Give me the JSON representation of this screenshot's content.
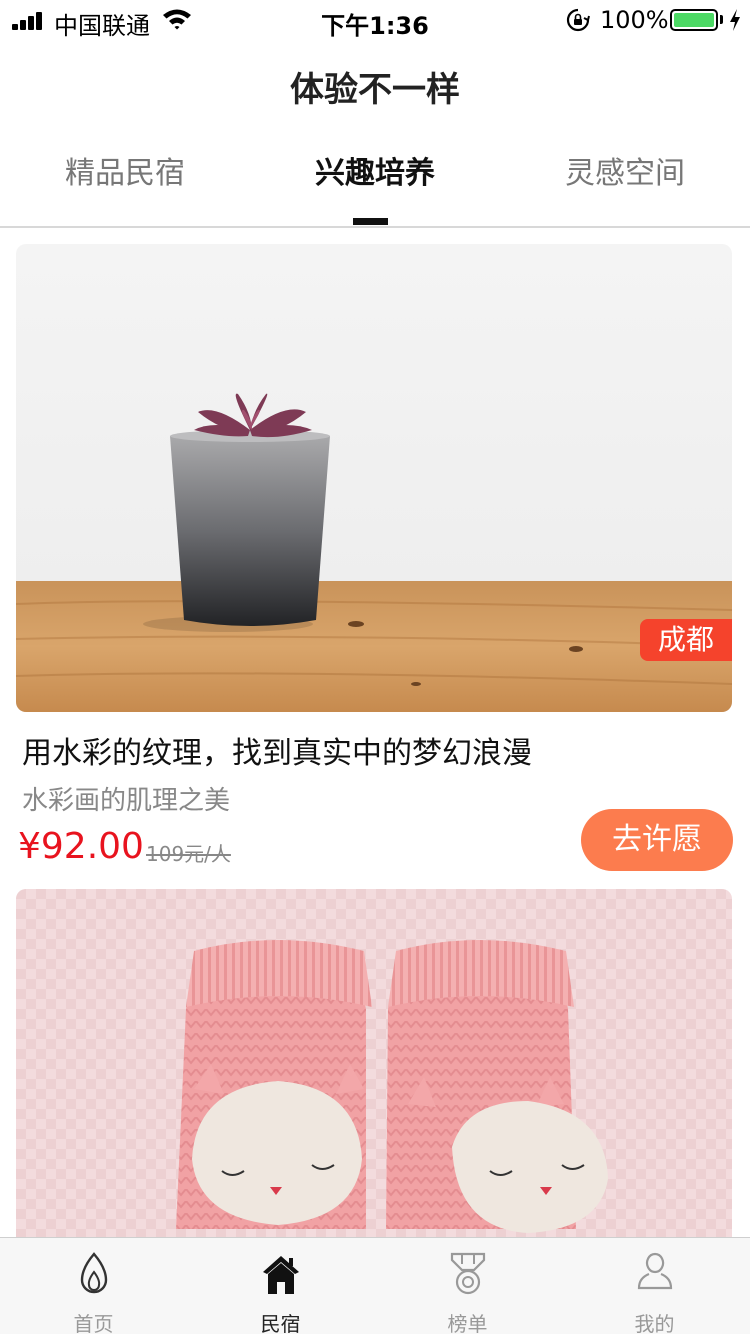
{
  "status_bar": {
    "carrier": "中国联通",
    "time": "下午1:36",
    "battery": "100%",
    "battery_color": "#4cd964"
  },
  "header": {
    "title": "体验不一样"
  },
  "tabs": [
    {
      "label": "精品民宿",
      "active": false
    },
    {
      "label": "兴趣培养",
      "active": true
    },
    {
      "label": "灵感空间",
      "active": false
    }
  ],
  "cards": [
    {
      "image": "succulent-pot-photo",
      "city": "成都",
      "title": "用水彩的纹理，找到真实中的梦幻浪漫",
      "subtitle": "水彩画的肌理之美",
      "price": "¥92.00",
      "original_price": "109元/人",
      "action_label": "去许愿"
    },
    {
      "image": "pink-knitted-baby-booties-photo"
    }
  ],
  "bottom_nav": [
    {
      "label": "首页",
      "icon": "flame-icon",
      "active": false
    },
    {
      "label": "民宿",
      "icon": "home-icon",
      "active": true
    },
    {
      "label": "榜单",
      "icon": "medal-icon",
      "active": false
    },
    {
      "label": "我的",
      "icon": "person-icon",
      "active": false
    }
  ],
  "colors": {
    "accent_red": "#e8131e",
    "badge_red": "#f5432c",
    "button_orange": "#fc7c4e"
  }
}
